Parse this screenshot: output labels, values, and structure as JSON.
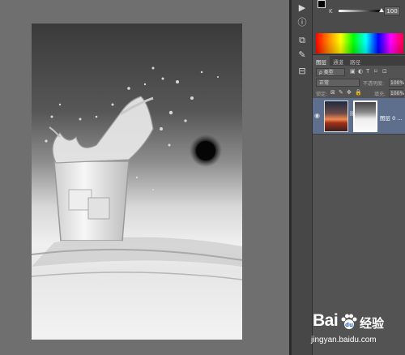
{
  "color_panel": {
    "channel_label": "K",
    "channel_value": "100",
    "foreground_color": "#000000",
    "background_color": "#ffffff"
  },
  "layers_panel": {
    "tabs": [
      {
        "label": "图层",
        "active": true
      },
      {
        "label": "通道",
        "active": false
      },
      {
        "label": "路径",
        "active": false
      }
    ],
    "filter_kind": "ρ 类型",
    "blend_mode": "正常",
    "opacity_label": "不透明度:",
    "opacity_value": "100%",
    "lock_label": "锁定:",
    "fill_label": "填充:",
    "fill_value": "100%",
    "layers": [
      {
        "name": "图层 0 ...",
        "visible": true,
        "selected": true
      }
    ]
  },
  "toolstrip": {
    "icons": [
      "play-icon",
      "info-icon",
      "clone-source-icon",
      "brush-icon",
      "adjust-icon"
    ]
  },
  "watermark": {
    "brand": "Bai",
    "brand_cn": "经验",
    "url": "jingyan.baidu.com"
  }
}
